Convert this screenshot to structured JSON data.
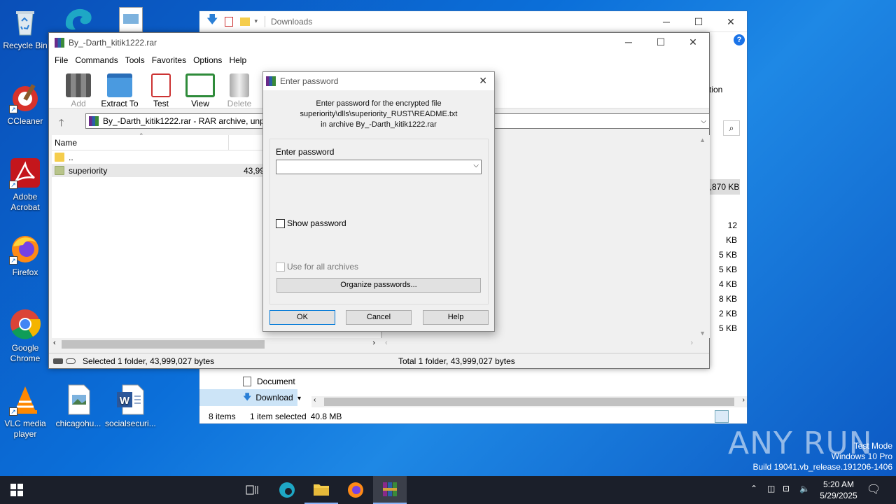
{
  "desktop": {
    "icons": [
      {
        "label": "Recycle Bin",
        "icon": "recycle-bin-icon"
      },
      {
        "label": "CCleaner",
        "icon": "ccleaner-icon"
      },
      {
        "label": "Adobe Acrobat",
        "icon": "acrobat-icon"
      },
      {
        "label": "Firefox",
        "icon": "firefox-icon"
      },
      {
        "label": "Google Chrome",
        "icon": "chrome-icon"
      },
      {
        "label": "VLC media player",
        "icon": "vlc-icon"
      },
      {
        "label": "chicagohu...",
        "icon": "image-file-icon"
      },
      {
        "label": "socialsecuri...",
        "icon": "word-doc-icon"
      }
    ],
    "watermark": {
      "brand": "ANY RUN",
      "line1": "Test Mode",
      "line2": "Windows 10 Pro",
      "line3": "Build 19041.vb_release.191206-1406"
    }
  },
  "explorer": {
    "title": "Downloads",
    "nav_items": [
      "Document",
      "Download"
    ],
    "right_partial": {
      "label": "tion",
      "size_total": ",870 KB",
      "sizes": [
        "12 KB",
        "5 KB",
        "5 KB",
        "4 KB",
        "8 KB",
        "2 KB",
        "5 KB"
      ]
    },
    "status": {
      "items": "8 items",
      "selected": "1 item selected",
      "size": "40.8 MB"
    }
  },
  "winrar": {
    "title": "By_-Darth_kitik1222.rar",
    "menu": [
      "File",
      "Commands",
      "Tools",
      "Favorites",
      "Options",
      "Help"
    ],
    "toolbar": [
      {
        "label": "Add",
        "disabled": true
      },
      {
        "label": "Extract To",
        "disabled": false
      },
      {
        "label": "Test",
        "disabled": false
      },
      {
        "label": "View",
        "disabled": false
      },
      {
        "label": "Delete",
        "disabled": true
      }
    ],
    "address": "By_-Darth_kitik1222.rar - RAR archive, unpa",
    "columns": {
      "name": "Name"
    },
    "rows": [
      {
        "name": "..",
        "size": ""
      },
      {
        "name": "superiority",
        "size": "43,99"
      }
    ],
    "status_left": "Selected 1 folder, 43,999,027 bytes",
    "status_right": "Total 1 folder, 43,999,027 bytes"
  },
  "dialog": {
    "title": "Enter password",
    "message_line1": "Enter password for the encrypted file",
    "message_line2": "superiority\\dlls\\superiority_RUST\\README.txt",
    "message_line3": "in archive By_-Darth_kitik1222.rar",
    "field_label": "Enter password",
    "password_value": "",
    "show_password": "Show password",
    "use_for_all": "Use for all archives",
    "organize": "Organize passwords...",
    "ok": "OK",
    "cancel": "Cancel",
    "help": "Help"
  },
  "taskbar": {
    "time": "5:20 AM",
    "date": "5/29/2025"
  }
}
